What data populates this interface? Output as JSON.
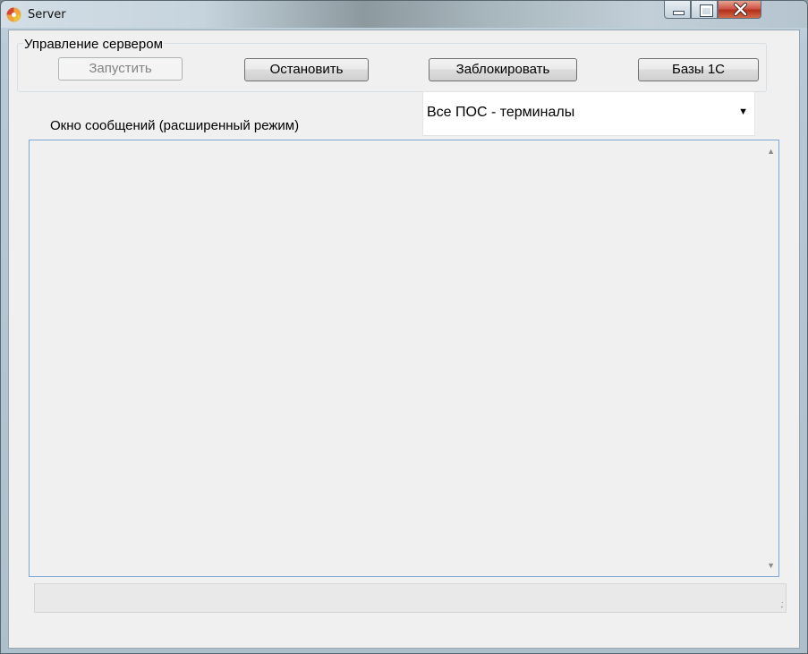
{
  "window": {
    "title": "Server",
    "controls": {
      "minimize": "minimize",
      "maximize": "maximize",
      "close": "close"
    }
  },
  "server_control": {
    "group_label": "Управление сервером",
    "start_label": "Запустить",
    "stop_label": "Остановить",
    "block_label": "Заблокировать",
    "bases_label": "Базы 1С"
  },
  "terminal_select": {
    "value": "Все ПОС - терминалы"
  },
  "messages": {
    "label": "Окно сообщений (расширенный режим)"
  },
  "icons": {
    "app": "app-icon",
    "combo_arrow": "chevron-down-icon",
    "scroll_up": "scroll-up-icon",
    "scroll_down": "scroll-down-icon",
    "resize_grip": "resize-grip-icon"
  },
  "colors": {
    "close_button": "#c5412f",
    "message_border": "#7aa7d6",
    "client_bg": "#f0f0f0"
  }
}
